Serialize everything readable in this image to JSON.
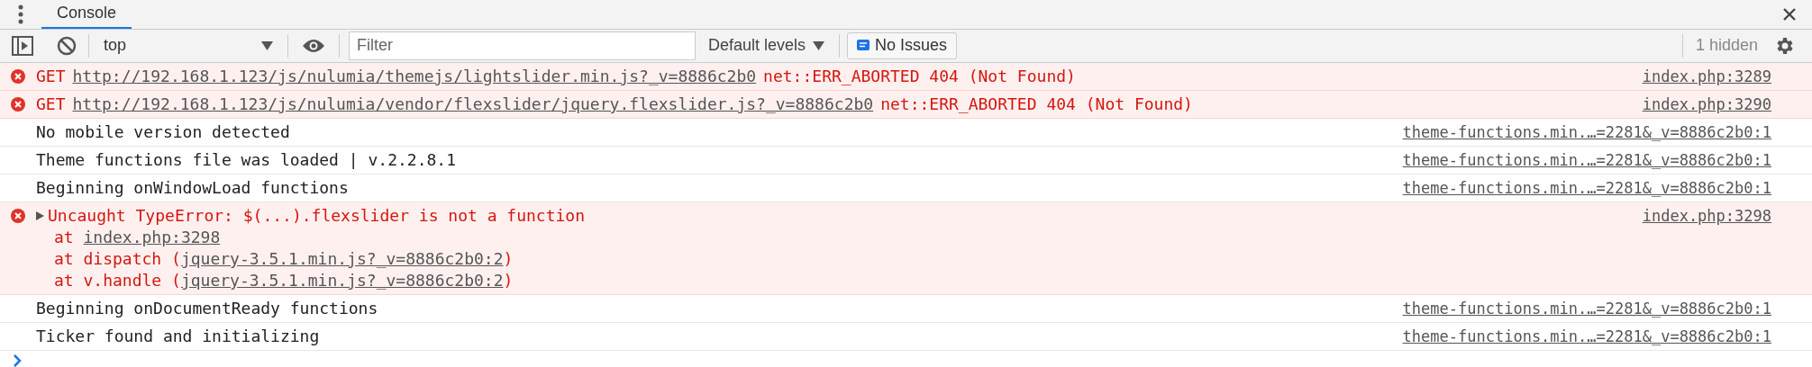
{
  "tabs": [
    {
      "label": "Console",
      "selected": true
    }
  ],
  "toolbar": {
    "context": "top",
    "filter": {
      "placeholder": "Filter"
    },
    "levels": "Default levels",
    "issues": "No Issues",
    "hidden_count": "1 hidden"
  },
  "messages": [
    {
      "kind": "network",
      "method": "GET",
      "url": "http://192.168.1.123/js/nulumia/themejs/lightslider.min.js?_v=8886c2b0",
      "status": "net::ERR_ABORTED 404 (Not Found)",
      "source": "index.php:3289"
    },
    {
      "kind": "network",
      "method": "GET",
      "url": "http://192.168.1.123/js/nulumia/vendor/flexslider/jquery.flexslider.js?_v=8886c2b0",
      "status": "net::ERR_ABORTED 404 (Not Found)",
      "source": "index.php:3290"
    },
    {
      "kind": "log",
      "text": "No mobile version detected",
      "source": "theme-functions.min.…=2281&_v=8886c2b0:1"
    },
    {
      "kind": "log",
      "text": "Theme functions file was loaded | v.2.2.8.1",
      "source": "theme-functions.min.…=2281&_v=8886c2b0:1"
    },
    {
      "kind": "log",
      "text": "Beginning onWindowLoad functions",
      "source": "theme-functions.min.…=2281&_v=8886c2b0:1"
    },
    {
      "kind": "exception",
      "expanded": false,
      "text": "Uncaught TypeError: $(...).flexslider is not a function",
      "source": "index.php:3298",
      "stack": [
        {
          "before": "at ",
          "link": "index.php:3298"
        },
        {
          "before": "at dispatch (",
          "link": "jquery-3.5.1.min.js?_v=8886c2b0:2",
          "after": ")"
        },
        {
          "before": "at v.handle (",
          "link": "jquery-3.5.1.min.js?_v=8886c2b0:2",
          "after": ")"
        }
      ]
    },
    {
      "kind": "log",
      "text": "Beginning onDocumentReady functions",
      "source": "theme-functions.min.…=2281&_v=8886c2b0:1"
    },
    {
      "kind": "log",
      "text": "Ticker found and initializing",
      "source": "theme-functions.min.…=2281&_v=8886c2b0:1"
    }
  ]
}
